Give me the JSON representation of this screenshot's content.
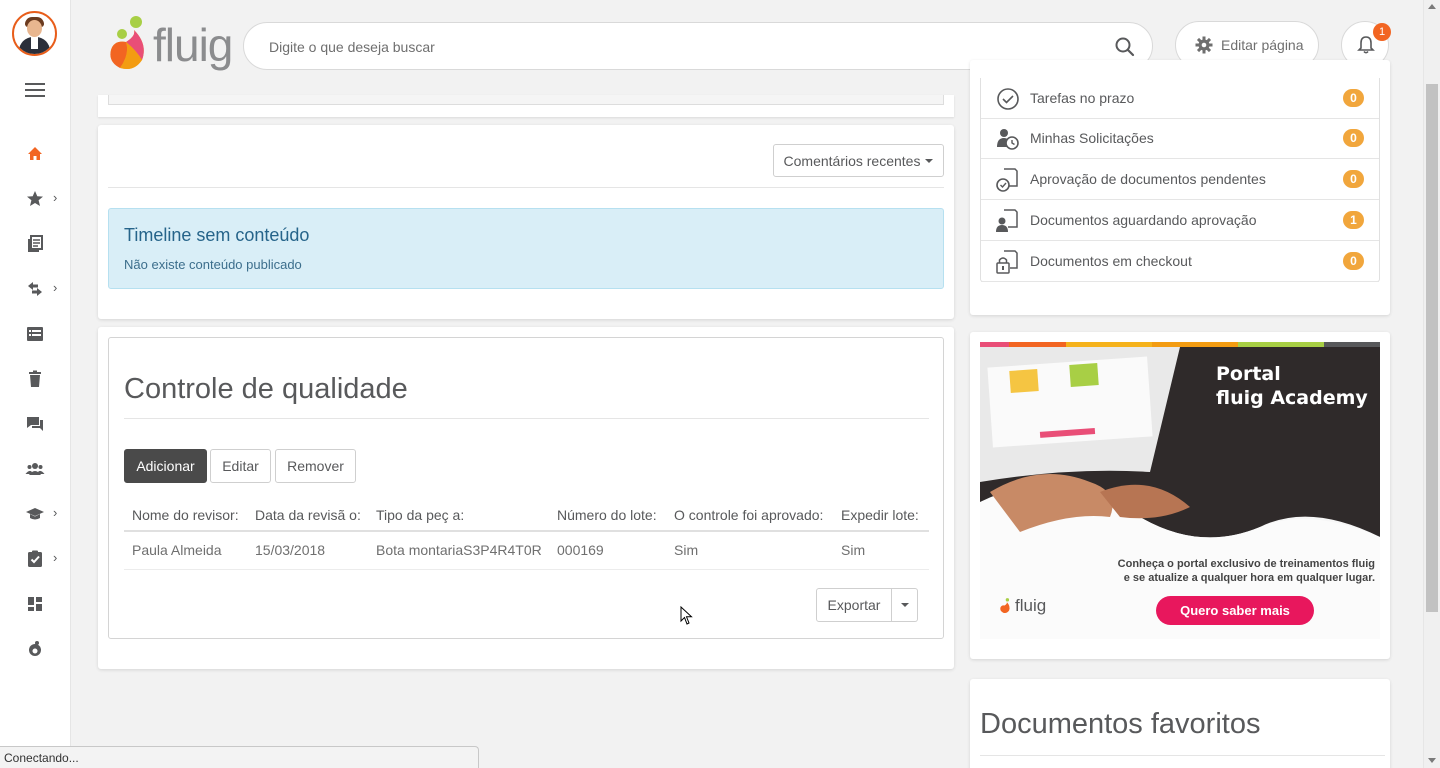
{
  "colors": {
    "accent": "#f26522",
    "badge": "#f1a63c",
    "info_bg": "#d9eef7",
    "primary_btn": "#4a4a4a"
  },
  "header": {
    "logo_text": "fluig",
    "search_placeholder": "Digite o que deseja buscar",
    "edit_page_label": "Editar página",
    "notifications_count": "1"
  },
  "sidebar": {
    "items": [
      {
        "icon": "home-icon"
      },
      {
        "icon": "star-icon"
      },
      {
        "icon": "documents-icon"
      },
      {
        "icon": "processes-icon"
      },
      {
        "icon": "list-icon"
      },
      {
        "icon": "trash-icon"
      },
      {
        "icon": "chat-icon"
      },
      {
        "icon": "people-icon"
      },
      {
        "icon": "graduation-cap-icon"
      },
      {
        "icon": "task-icon"
      },
      {
        "icon": "dashboard-icon"
      },
      {
        "icon": "fluig-icon"
      }
    ]
  },
  "timeline": {
    "filter_label": "Comentários recentes",
    "empty_title": "Timeline sem conteúdo",
    "empty_desc": "Não existe conteúdo publicado"
  },
  "quality": {
    "title": "Controle de qualidade",
    "add_label": "Adicionar",
    "edit_label": "Editar",
    "remove_label": "Remover",
    "columns": [
      "Nome do revisor:",
      "Data da revisã o:",
      "Tipo da peç a:",
      "Número do lote:",
      "O controle foi aprovado:",
      "Expedir lote:"
    ],
    "rows": [
      [
        "Paula Almeida",
        "15/03/2018",
        "Bota montariaS3P4R4T0R",
        "000169",
        "Sim",
        "Sim"
      ]
    ],
    "export_label": "Exportar"
  },
  "tasks": [
    {
      "label": "Tarefas no prazo",
      "count": "0",
      "icon": "clock-check-icon"
    },
    {
      "label": "Minhas Solicitações",
      "count": "0",
      "icon": "user-clock-icon"
    },
    {
      "label": "Aprovação de documentos pendentes",
      "count": "0",
      "icon": "document-clock-icon"
    },
    {
      "label": "Documentos aguardando aprovação",
      "count": "1",
      "icon": "document-user-icon"
    },
    {
      "label": "Documentos em checkout",
      "count": "0",
      "icon": "document-lock-icon"
    }
  ],
  "banner": {
    "title_line1": "Portal",
    "title_line2": "fluig Academy",
    "text_line1": "Conheça o portal exclusivo de treinamentos fluig",
    "text_line2": "e se atualize a qualquer hora em qualquer lugar.",
    "cta": "Quero saber mais",
    "logo_text": "fluig"
  },
  "favorites": {
    "title": "Documentos favoritos"
  },
  "status_bar": "Conectando..."
}
